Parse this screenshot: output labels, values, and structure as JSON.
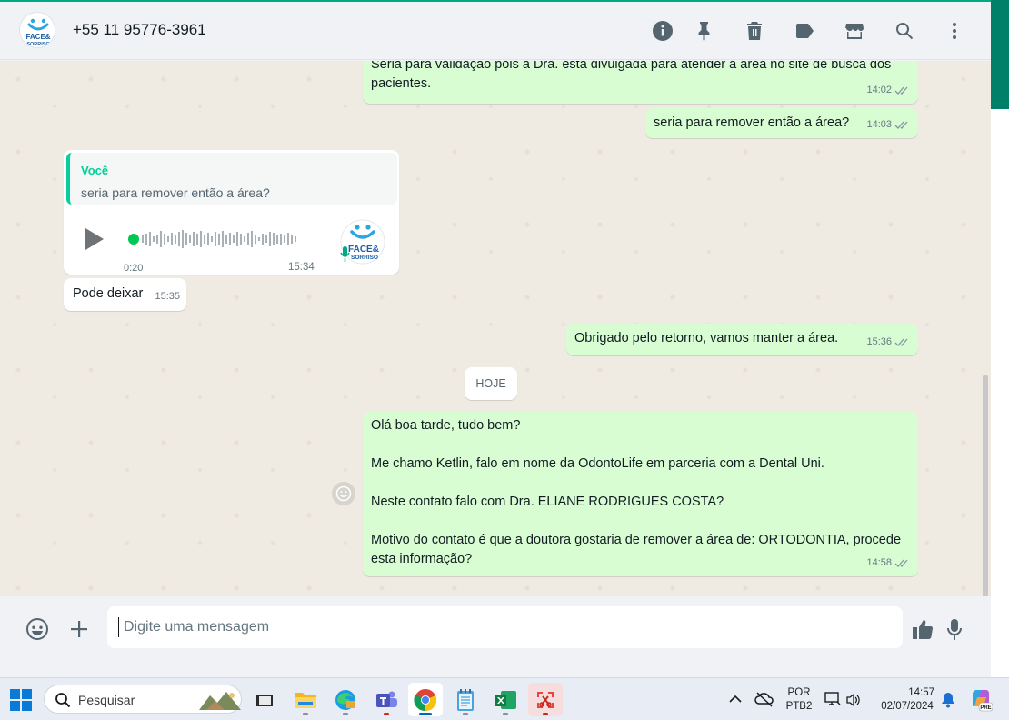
{
  "header": {
    "contact_name": "+55 11 95776-3961",
    "avatar_text_top": "FACE&",
    "avatar_text_bottom": "SORRISO",
    "icons": [
      "info-icon",
      "pin-icon",
      "delete-icon",
      "label-icon",
      "store-icon",
      "search-icon",
      "menu-icon"
    ]
  },
  "messages": [
    {
      "dir": "out",
      "text": "Seria para validação pois a Dra. está divulgada para atender a área no site de busca dos pacientes.",
      "time": "14:02"
    },
    {
      "dir": "out",
      "text": "seria para remover então a área?",
      "time": "14:03"
    },
    {
      "dir": "in",
      "type": "audio",
      "quote_author": "Você",
      "quote_text": "seria para remover então a área?",
      "duration": "0:20",
      "time": "15:34"
    },
    {
      "dir": "in",
      "text": "Pode deixar",
      "time": "15:35"
    },
    {
      "dir": "out",
      "text": "Obrigado pelo retorno, vamos manter a área.",
      "time": "15:36"
    },
    {
      "dir": "out",
      "text": "Olá boa tarde, tudo bem?\n\nMe chamo Ketlin, falo em nome da OdontoLife em parceria com a Dental Uni.\n\nNeste contato falo com Dra. ELIANE RODRIGUES COSTA?\n\nMotivo do contato é que a doutora gostaria de remover a área de: ORTODONTIA, procede esta informação?",
      "time": "14:58"
    }
  ],
  "date_chip": "HOJE",
  "composer": {
    "placeholder": "Digite uma mensagem"
  },
  "taskbar": {
    "search_placeholder": "Pesquisar",
    "lang_line1": "POR",
    "lang_line2": "PTB2",
    "time": "14:57",
    "date": "02/07/2024",
    "copilot_badge": "PRE"
  },
  "colors": {
    "outgoing_bubble": "#d9fdd3",
    "incoming_bubble": "#ffffff",
    "accent": "#00a884",
    "chat_bg": "#efeae2"
  }
}
